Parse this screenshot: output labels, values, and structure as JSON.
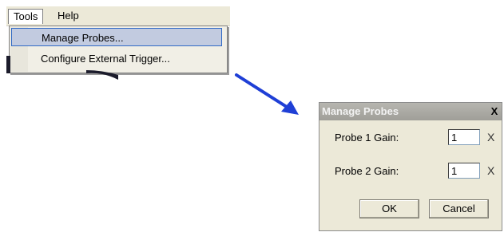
{
  "menubar": {
    "tools_label": "Tools",
    "help_label": "Help"
  },
  "tools_menu": {
    "items": [
      {
        "label": "Manage Probes...",
        "highlighted": true
      },
      {
        "label": "Configure External Trigger..."
      }
    ]
  },
  "dialog": {
    "title": "Manage Probes",
    "close_label": "X",
    "probes": [
      {
        "label": "Probe 1 Gain:",
        "value": "1",
        "unit": "X"
      },
      {
        "label": "Probe 2 Gain:",
        "value": "1",
        "unit": "X"
      }
    ],
    "ok_label": "OK",
    "cancel_label": "Cancel"
  },
  "colors": {
    "arrow": "#1f3fd6",
    "highlight": "#c2cbe0",
    "highlight_border": "#316ac5",
    "dialog_bg": "#ece9d8",
    "titlebar": "#a7a6a0"
  }
}
